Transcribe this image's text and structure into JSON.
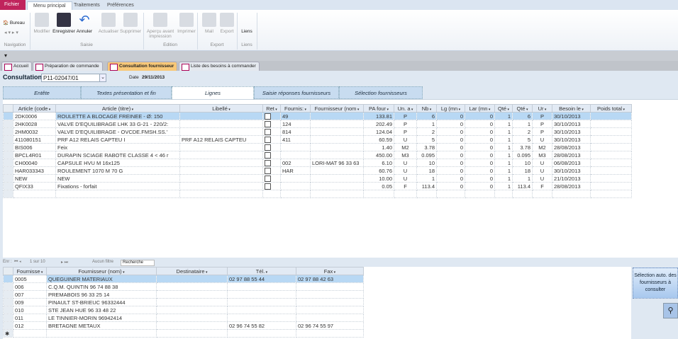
{
  "ribbon": {
    "tabs": [
      "Fichier",
      "Menu principal",
      "Traitements",
      "Préférences"
    ],
    "nav": {
      "bureau": "Bureau",
      "group": "Navigation"
    },
    "buttons": [
      {
        "label": "Modifier",
        "enabled": false
      },
      {
        "label": "Enregistrer",
        "enabled": true
      },
      {
        "label": "Annuler",
        "enabled": true
      },
      {
        "label": "Actualiser",
        "enabled": false
      },
      {
        "label": "Supprimer",
        "enabled": false
      },
      {
        "label": "Aperçu avant impression",
        "enabled": false
      },
      {
        "label": "Imprimer",
        "enabled": false
      },
      {
        "label": "Mail",
        "enabled": false
      },
      {
        "label": "Export",
        "enabled": false
      },
      {
        "label": "Liens",
        "enabled": true
      }
    ],
    "groups": [
      "Saisie",
      "Edition",
      "Export",
      "Liens"
    ]
  },
  "doc_tabs": [
    "Accueil",
    "Préparation de commande",
    "Consultation fournisseur",
    "Liste des besoins à commander"
  ],
  "header": {
    "consultation_label": "Consultation",
    "consultation_value": "P11-02047/01",
    "date_label": "Date",
    "date_value": "29/11/2013"
  },
  "form_tabs": [
    "Entête",
    "Textes présentation et fin",
    "Lignes",
    "Saisie réponses fournisseurs",
    "Sélection fournisseurs"
  ],
  "lines": {
    "columns": [
      "Article (code",
      "Article (titre)",
      "Libellé",
      "Ret",
      "Fournis:",
      "Fournisseur (nom",
      "PA four",
      "Un. a",
      "Nb",
      "Lg (mn",
      "Lar (mn",
      "Qté",
      "Qté",
      "Ur",
      "Besoin le",
      "Poids total"
    ],
    "rows": [
      [
        "2DK0006",
        "ROULETTE A BLOCAGE FREINEE - Ø: 150",
        "",
        "",
        "49",
        "",
        "133.81",
        "P",
        "6",
        "0",
        "0",
        "1",
        "6",
        "P",
        "30/10/2013",
        ""
      ],
      [
        "2HK0028",
        "VALVE D'EQUILIBRAGE LHK 33 G-21 - 220/2:",
        "",
        "",
        "124",
        "",
        "202.49",
        "P",
        "1",
        "0",
        "0",
        "1",
        "1",
        "P",
        "30/10/2013",
        ""
      ],
      [
        "2HM0032",
        "VALVE D'EQUILIBRAGE - OVCDE.FMSH.SS.'",
        "",
        "",
        "814",
        "",
        "124.04",
        "P",
        "2",
        "0",
        "0",
        "1",
        "2",
        "P",
        "30/10/2013",
        ""
      ],
      [
        "411080151",
        "PRF A12       RELAIS CAPTEU I",
        "PRF A12       RELAIS CAPTEU",
        "",
        "411",
        "",
        "60.59",
        "U",
        "5",
        "0",
        "0",
        "1",
        "5",
        "U",
        "30/10/2013",
        ""
      ],
      [
        "BIS006",
        "Feix",
        "",
        "",
        "",
        "",
        "1.40",
        "M2",
        "3.78",
        "0",
        "0",
        "1",
        "3.78",
        "M2",
        "28/08/2013",
        ""
      ],
      [
        "BPCL4R01",
        "DURAPIN SCIAGE RABOTE CLASSE 4 < 46 r",
        "",
        "",
        "",
        "",
        "450.00",
        "M3",
        "0.095",
        "0",
        "0",
        "1",
        "0.095",
        "M3",
        "28/08/2013",
        ""
      ],
      [
        "CH00040",
        "CAPSULE HVU M 16x125",
        "",
        "",
        "002",
        "LORI-MAT 96 33 63",
        "6.10",
        "U",
        "10",
        "0",
        "0",
        "1",
        "10",
        "U",
        "06/08/2013",
        ""
      ],
      [
        "HAR033343",
        "ROULEMENT 1070 M 70 G",
        "",
        "",
        "HAR",
        "",
        "60.76",
        "U",
        "18",
        "0",
        "0",
        "1",
        "18",
        "U",
        "30/10/2013",
        ""
      ],
      [
        "NEW",
        "NEW",
        "",
        "",
        "",
        "",
        "10.00",
        "U",
        "1",
        "0",
        "0",
        "1",
        "1",
        "U",
        "21/10/2013",
        ""
      ],
      [
        "QFIX33",
        "Fixations - forfait",
        "",
        "",
        "",
        "",
        "0.05",
        "F",
        "113.4",
        "0",
        "0",
        "1",
        "113.4",
        "F",
        "28/08/2013",
        ""
      ]
    ]
  },
  "navbar": {
    "prefix": "Enr :",
    "position": "1 sur 10",
    "filter": "Aucun filtre",
    "search": "Recherche"
  },
  "suppliers": {
    "columns": [
      "Fournisse",
      "Fournisseur (nom)",
      "Destinataire",
      "Tél.",
      "Fax"
    ],
    "rows": [
      [
        "0005",
        "QUEGUINER MATERIAUX",
        "",
        "02 97 88 55 44",
        "02 97 88 42 63"
      ],
      [
        "006",
        "C.Q.M. QUINTIN 96 74 88 38",
        "",
        "",
        ""
      ],
      [
        "007",
        "PREMABOIS 96 33 25 14",
        "",
        "",
        ""
      ],
      [
        "009",
        "PINAULT ST-BRIEUC 96332444",
        "",
        "",
        ""
      ],
      [
        "010",
        "STE JEAN HUE 96 33 48 22",
        "",
        "",
        ""
      ],
      [
        "011",
        "LE TINNIER-MORIN 96942414",
        "",
        "",
        ""
      ],
      [
        "012",
        "BRETAGNE METAUX",
        "",
        "02  96 74 55 82",
        "02  96 74 55 97"
      ]
    ]
  },
  "auto_select_button": "Sélection auto. des fournisseurs à consulter",
  "colors": {
    "fichier": "#c0245c",
    "active_tab": "#f8c878",
    "selected_row": "#b8d8f4"
  }
}
